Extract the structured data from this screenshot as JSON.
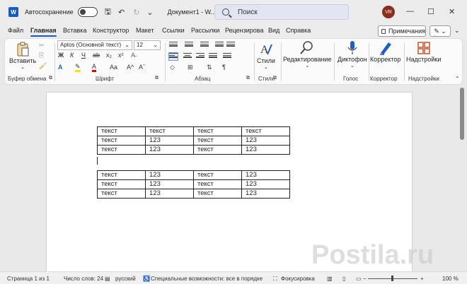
{
  "titlebar": {
    "app_icon": "W",
    "autosave_label": "Автосохранение",
    "undo_icon": "↶",
    "redo_icon": "↻",
    "more_icon": "⌄",
    "doc_title": "Документ1 - W...",
    "search_placeholder": "Поиск",
    "user_initials": "VR",
    "minimize": "—",
    "maximize": "☐",
    "close": "✕"
  },
  "tabs": [
    "Файл",
    "Главная",
    "Вставка",
    "Конструктор",
    "Макет",
    "Ссылки",
    "Рассылки",
    "Рецензирова",
    "Вид",
    "Справка"
  ],
  "active_tab": "Главная",
  "menubar_right": {
    "notes": "Примечания",
    "edit_icon": "✎ ⌄",
    "collapse_icon": "⌄"
  },
  "ribbon": {
    "clipboard": {
      "paste": "Вставить",
      "label": "Буфер обмена"
    },
    "font": {
      "font_name": "Aptos (Основной текст)",
      "font_size": "12",
      "bold": "Ж",
      "italic": "К",
      "underline": "Ч",
      "grow": "A^",
      "shrink": "Aˇ",
      "case": "Aa",
      "label": "Шрифт"
    },
    "paragraph": {
      "label": "Абзац",
      "pilcrow": "¶"
    },
    "styles": {
      "btn": "Стили",
      "label": "Стили"
    },
    "editing": {
      "btn": "Редактирование"
    },
    "voice": {
      "btn": "Диктофон",
      "label": "Голос"
    },
    "editor": {
      "btn": "Корректор",
      "label": "Корректор"
    },
    "addins": {
      "btn": "Надстройки",
      "label": "Надстройки"
    }
  },
  "tables": [
    [
      [
        "текст",
        "текст",
        "текст",
        "текст"
      ],
      [
        "текст",
        "123",
        "текст",
        "123"
      ],
      [
        "текст",
        "123",
        "текст",
        "123"
      ]
    ],
    [
      [
        "текст",
        "123",
        "текст",
        "123"
      ],
      [
        "текст",
        "123",
        "текст",
        "123"
      ],
      [
        "текст",
        "123",
        "текст",
        "123"
      ]
    ]
  ],
  "status": {
    "page": "Страница 1 из 1",
    "words": "Число слов: 24",
    "lang": "русский",
    "accessibility": "Специальные возможности: все в порядке",
    "focus": "Фокусировка",
    "zoom": "100 %",
    "zoom_minus": "−",
    "zoom_plus": "+"
  },
  "watermark": "Postila.ru"
}
